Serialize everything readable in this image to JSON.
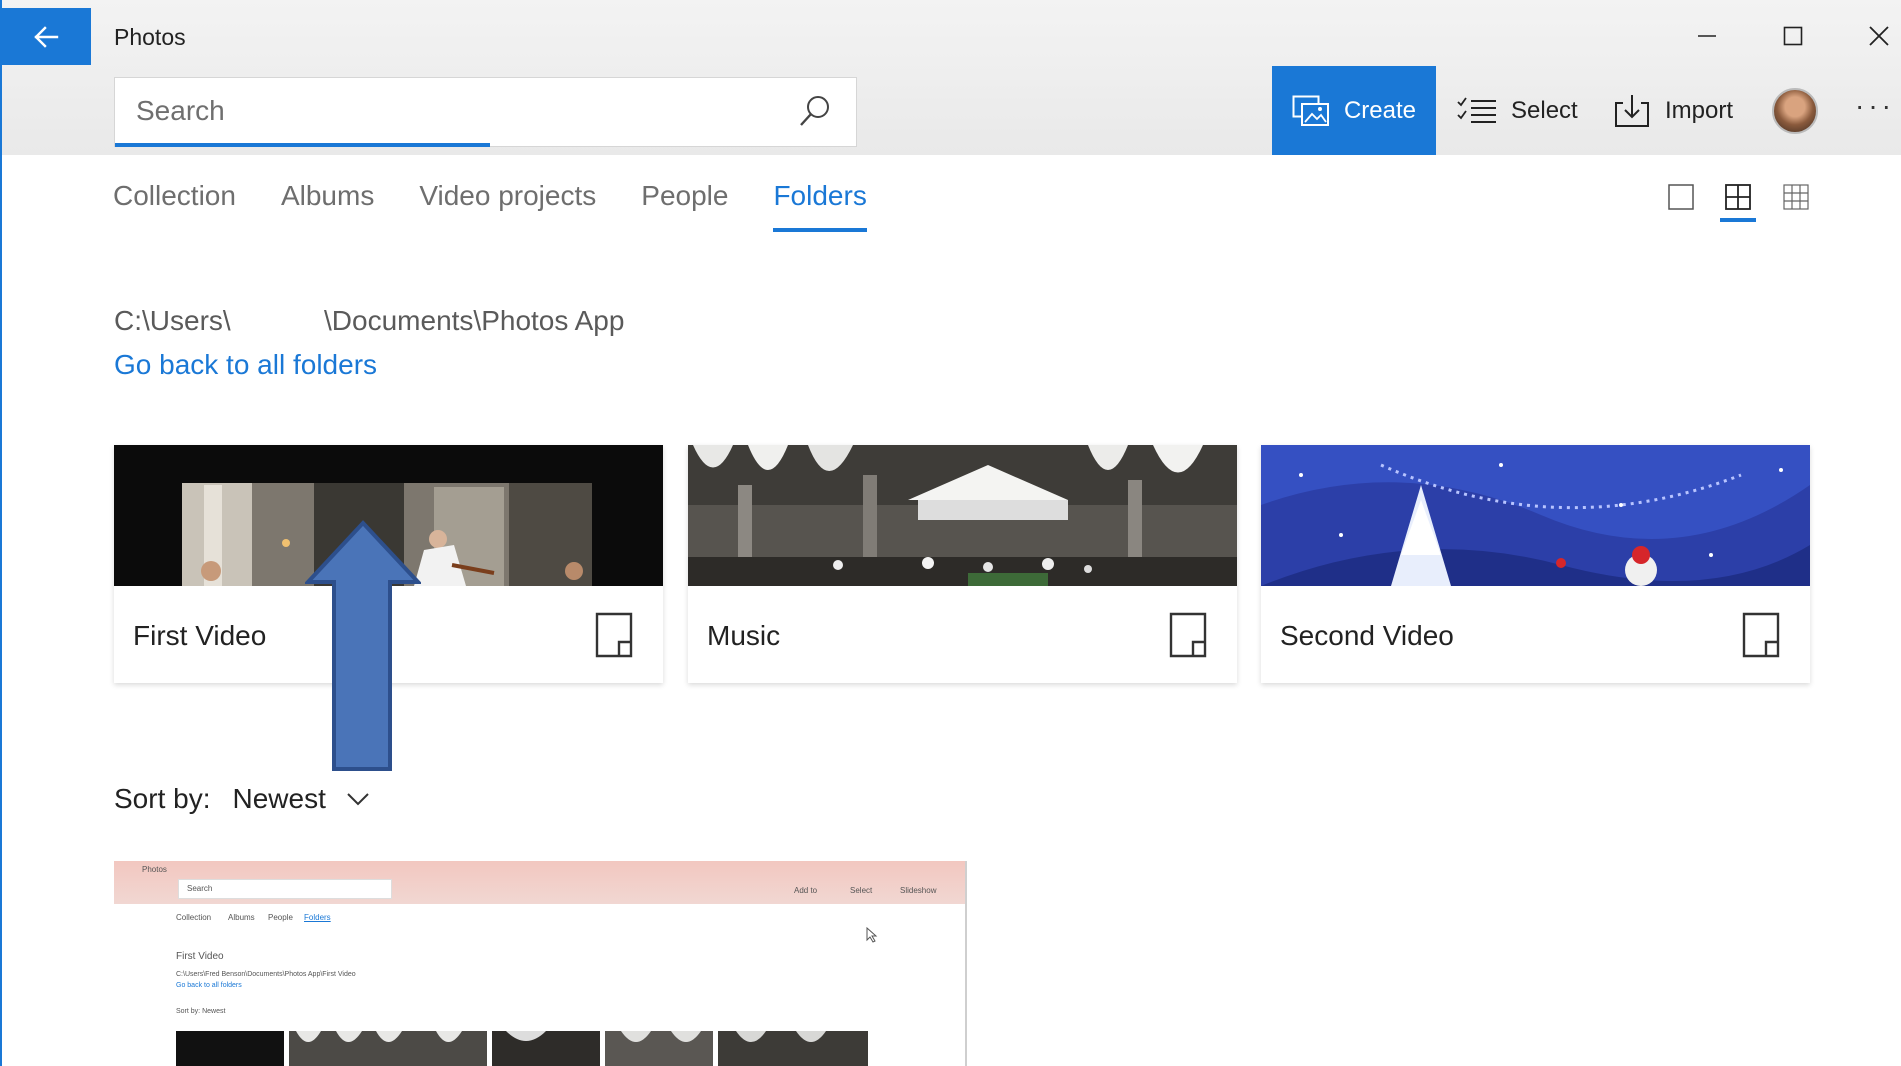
{
  "app": {
    "title": "Photos",
    "accent_color": "#1a78d6"
  },
  "titlebar": {
    "back_icon": "arrow-left-icon",
    "minimize_icon": "minimize-icon",
    "maximize_icon": "maximize-icon",
    "close_icon": "close-icon"
  },
  "search": {
    "placeholder": "Search",
    "value": "",
    "icon": "search-icon"
  },
  "commands": {
    "create_label": "Create",
    "select_label": "Select",
    "import_label": "Import",
    "more_label": "···"
  },
  "tabs": [
    {
      "label": "Collection",
      "active": false
    },
    {
      "label": "Albums",
      "active": false
    },
    {
      "label": "Video projects",
      "active": false
    },
    {
      "label": "People",
      "active": false
    },
    {
      "label": "Folders",
      "active": true
    }
  ],
  "view_modes": [
    "large-tiles-icon",
    "medium-tiles-icon",
    "small-tiles-icon"
  ],
  "view_mode_selected": "medium-tiles-icon",
  "breadcrumb": {
    "path": "C:\\Users\\            \\Documents\\Photos App",
    "back_link": "Go back to all folders"
  },
  "folders": [
    {
      "name": "First Video",
      "icon": "folder-icon"
    },
    {
      "name": "Music",
      "icon": "folder-icon"
    },
    {
      "name": "Second Video",
      "icon": "folder-icon"
    }
  ],
  "sort": {
    "label": "Sort by:",
    "value": "Newest"
  },
  "video_thumbnail": {
    "title": "Photos",
    "search": "Search",
    "tabs": [
      "Collection",
      "Albums",
      "People",
      "Folders"
    ],
    "commands": [
      "Add to",
      "Select",
      "Slideshow"
    ],
    "folder_title": "First Video",
    "path": "C:\\Users\\Fred Benson\\Documents\\Photos App\\First Video",
    "back_link": "Go back to all folders",
    "sort": "Sort by:  Newest"
  }
}
